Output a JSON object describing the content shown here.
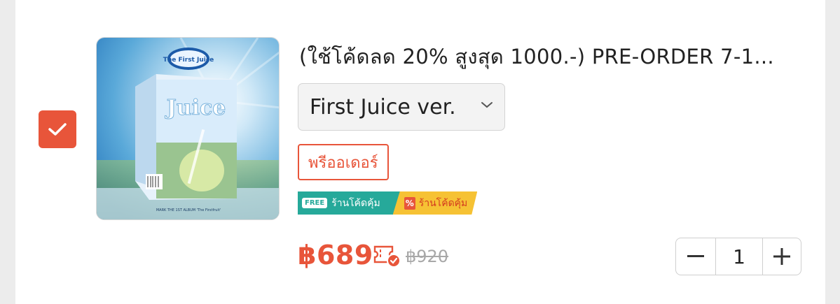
{
  "item": {
    "title": "(ใช้โค้ดลด 20% สูงสุด 1000.-) PRE-ORDER 7-1...",
    "variant": "First Juice ver.",
    "preorder_label": "พรีออเดอร์",
    "badges": {
      "free_tag": "FREE",
      "free_label": "ร้านโค้ดคุ้ม",
      "coupon_label": "ร้านโค้ดคุ้ม"
    },
    "price": "฿689",
    "original_price": "฿920",
    "quantity": "1",
    "selected": true
  },
  "product_image": {
    "brand_text": "The First Juice",
    "caption": "MARK THE 1ST ALBUM 'The Firstfruit'"
  },
  "colors": {
    "accent": "#e8553a",
    "free_badge": "#26a99a",
    "coupon_badge": "#f6c234"
  },
  "icons": {
    "checkbox": "check-icon",
    "variant": "chevron-down-icon",
    "voucher": "voucher-icon",
    "stepper_minus": "minus-icon",
    "stepper_plus": "plus-icon"
  }
}
